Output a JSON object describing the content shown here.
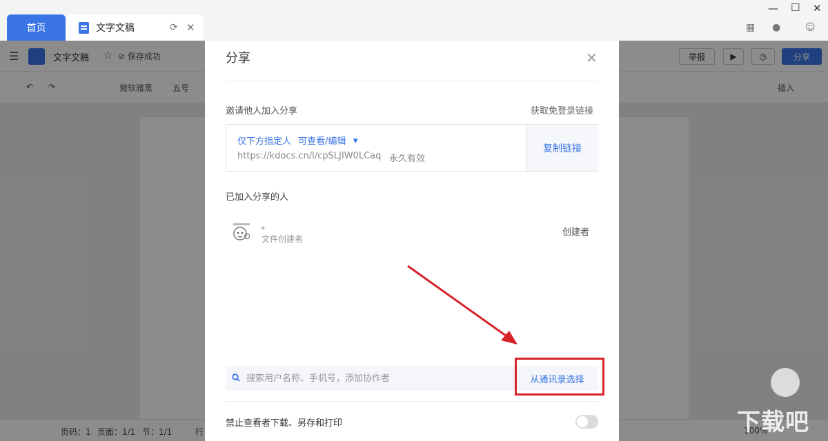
{
  "tabs": {
    "home_label": "首页",
    "doc_label": "文字文稿"
  },
  "app_toolbar": {
    "doc_title": "文字文稿",
    "save_status": "保存成功",
    "report_label": "举报",
    "share_label": "分享"
  },
  "format_toolbar": {
    "font_name": "微软雅黑",
    "font_size": "五号",
    "insert_label": "插入"
  },
  "status_bar": {
    "page_number": "页码：1",
    "page_count": "页面：1/1",
    "section": "节：1/1",
    "line_label": "行",
    "zoom": "100%"
  },
  "dialog": {
    "title": "分享",
    "invite_label": "邀请他人加入分享",
    "get_login_free_link": "获取免登录链接",
    "permission": "仅下方指定人",
    "permission_mode": "可查看/编辑",
    "share_url": "https://kdocs.cn/l/cpSLJIW0LCaq",
    "validity": "永久有效",
    "copy_link": "复制链接",
    "joined_label": "已加入分享的人",
    "member": {
      "name": "。",
      "subtitle": "文件创建者",
      "role": "创建者"
    },
    "search_placeholder": "搜索用户名称、手机号，添加协作者",
    "contacts_button": "从通讯录选择",
    "restrict_label": "禁止查看者下载、另存和打印",
    "restrict_enabled": false
  },
  "colors": {
    "accent": "#3a74e5",
    "highlight": "#d8232a"
  },
  "watermark": "下载吧"
}
